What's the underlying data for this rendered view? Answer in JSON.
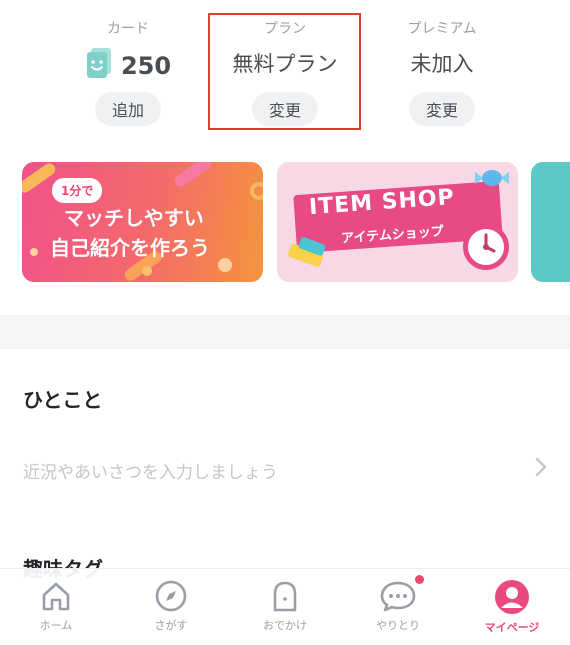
{
  "stats": {
    "card": {
      "label": "カード",
      "value": "250",
      "button": "追加"
    },
    "plan": {
      "label": "プラン",
      "value": "無料プラン",
      "button": "変更"
    },
    "premium": {
      "label": "プレミアム",
      "value": "未加入",
      "button": "変更"
    }
  },
  "banners": [
    {
      "tag": "1分で",
      "line1": "マッチしやすい",
      "line2": "自己紹介を作ろう"
    },
    {
      "title": "ITEM SHOP",
      "subtitle": "アイテムショップ"
    }
  ],
  "profile": {
    "comment_title": "ひとこと",
    "comment_placeholder": "近況やあいさつを入力しましょう",
    "interests_title": "趣味タグ"
  },
  "tabbar": {
    "items": [
      {
        "label": "ホーム",
        "icon": "home-icon"
      },
      {
        "label": "さがす",
        "icon": "compass-icon"
      },
      {
        "label": "おでかけ",
        "icon": "ghost-icon"
      },
      {
        "label": "やりとり",
        "icon": "chat-bubble-icon"
      },
      {
        "label": "マイページ",
        "icon": "user-icon"
      }
    ],
    "active_index": 4
  },
  "colors": {
    "accent": "#e84a7f",
    "highlight_border": "#d9402c",
    "card_icon": "#7fd0c8"
  }
}
